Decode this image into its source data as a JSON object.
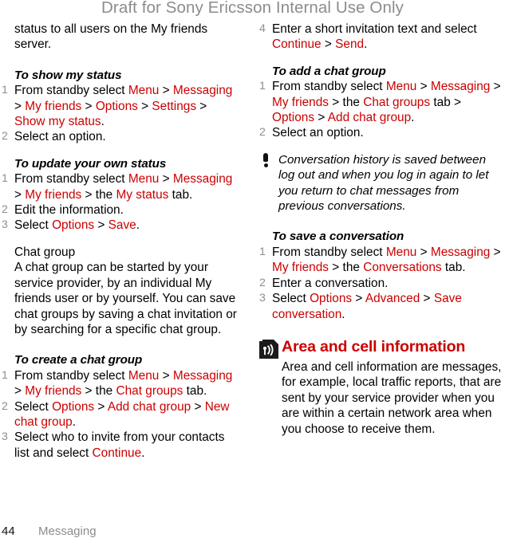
{
  "watermark": "Draft for Sony Ericsson Internal Use Only",
  "footer": {
    "page_number": "44",
    "chapter_title": "Messaging"
  },
  "colors": {
    "ui_term": "#cc0000",
    "watermark": "#8c8c8c",
    "step_number": "#8e8e8e",
    "body_text": "#000000"
  },
  "left_column": {
    "continued_paragraph": "status to all users on the My friends server.",
    "sections": [
      {
        "heading": "To show my status",
        "steps": [
          {
            "num": "1",
            "parts": [
              {
                "t": "From standby select ",
                "s": "plain"
              },
              {
                "t": "Menu",
                "s": "ui"
              },
              {
                "t": " > ",
                "s": "plain"
              },
              {
                "t": "Messaging",
                "s": "ui"
              },
              {
                "t": " > ",
                "s": "plain"
              },
              {
                "t": "My friends",
                "s": "ui"
              },
              {
                "t": " > ",
                "s": "plain"
              },
              {
                "t": "Options",
                "s": "ui"
              },
              {
                "t": " > ",
                "s": "plain"
              },
              {
                "t": "Settings",
                "s": "ui"
              },
              {
                "t": " > ",
                "s": "plain"
              },
              {
                "t": "Show my status",
                "s": "ui"
              },
              {
                "t": ".",
                "s": "plain"
              }
            ]
          },
          {
            "num": "2",
            "parts": [
              {
                "t": "Select an option.",
                "s": "plain"
              }
            ]
          }
        ]
      },
      {
        "heading": "To update your own status",
        "steps": [
          {
            "num": "1",
            "parts": [
              {
                "t": "From standby select ",
                "s": "plain"
              },
              {
                "t": "Menu",
                "s": "ui"
              },
              {
                "t": " > ",
                "s": "plain"
              },
              {
                "t": "Messaging",
                "s": "ui"
              },
              {
                "t": " > ",
                "s": "plain"
              },
              {
                "t": "My friends",
                "s": "ui"
              },
              {
                "t": " > the ",
                "s": "plain"
              },
              {
                "t": "My status",
                "s": "ui"
              },
              {
                "t": " tab.",
                "s": "plain"
              }
            ]
          },
          {
            "num": "2",
            "parts": [
              {
                "t": "Edit the information.",
                "s": "plain"
              }
            ]
          },
          {
            "num": "3",
            "parts": [
              {
                "t": "Select ",
                "s": "plain"
              },
              {
                "t": "Options",
                "s": "ui"
              },
              {
                "t": " > ",
                "s": "plain"
              },
              {
                "t": "Save",
                "s": "ui"
              },
              {
                "t": ".",
                "s": "plain"
              }
            ]
          }
        ]
      }
    ],
    "chat_group": {
      "heading": "Chat group",
      "body": "A chat group can be started by your service provider, by an individual My friends user or by yourself. You can save chat groups by saving a chat invitation or by searching for a specific chat group."
    },
    "create_chat_group": {
      "heading": "To create a chat group",
      "steps": [
        {
          "num": "1",
          "parts": [
            {
              "t": "From standby select ",
              "s": "plain"
            },
            {
              "t": "Menu",
              "s": "ui"
            },
            {
              "t": " > ",
              "s": "plain"
            },
            {
              "t": "Messaging",
              "s": "ui"
            },
            {
              "t": " > ",
              "s": "plain"
            },
            {
              "t": "My friends",
              "s": "ui"
            },
            {
              "t": " > the ",
              "s": "plain"
            },
            {
              "t": "Chat groups",
              "s": "ui"
            },
            {
              "t": " tab.",
              "s": "plain"
            }
          ]
        },
        {
          "num": "2",
          "parts": [
            {
              "t": "Select ",
              "s": "plain"
            },
            {
              "t": "Options",
              "s": "ui"
            },
            {
              "t": " > ",
              "s": "plain"
            },
            {
              "t": "Add chat group",
              "s": "ui"
            },
            {
              "t": " > ",
              "s": "plain"
            },
            {
              "t": "New chat group",
              "s": "ui"
            },
            {
              "t": ".",
              "s": "plain"
            }
          ]
        },
        {
          "num": "3",
          "parts": [
            {
              "t": "Select who to invite from your contacts list and select ",
              "s": "plain"
            },
            {
              "t": "Continue",
              "s": "ui"
            },
            {
              "t": ".",
              "s": "plain"
            }
          ]
        }
      ]
    }
  },
  "right_column": {
    "continued_step": {
      "num": "4",
      "parts": [
        {
          "t": "Enter a short invitation text and select ",
          "s": "plain"
        },
        {
          "t": "Continue",
          "s": "ui"
        },
        {
          "t": " > ",
          "s": "plain"
        },
        {
          "t": "Send",
          "s": "ui"
        },
        {
          "t": ".",
          "s": "plain"
        }
      ]
    },
    "add_chat_group": {
      "heading": "To add a chat group",
      "steps": [
        {
          "num": "1",
          "parts": [
            {
              "t": "From standby select ",
              "s": "plain"
            },
            {
              "t": "Menu",
              "s": "ui"
            },
            {
              "t": " > ",
              "s": "plain"
            },
            {
              "t": "Messaging",
              "s": "ui"
            },
            {
              "t": " > ",
              "s": "plain"
            },
            {
              "t": "My friends",
              "s": "ui"
            },
            {
              "t": " > the ",
              "s": "plain"
            },
            {
              "t": "Chat groups",
              "s": "ui"
            },
            {
              "t": " tab > ",
              "s": "plain"
            },
            {
              "t": "Options",
              "s": "ui"
            },
            {
              "t": " > ",
              "s": "plain"
            },
            {
              "t": "Add chat group",
              "s": "ui"
            },
            {
              "t": ".",
              "s": "plain"
            }
          ]
        },
        {
          "num": "2",
          "parts": [
            {
              "t": "Select an option.",
              "s": "plain"
            }
          ]
        }
      ]
    },
    "note": {
      "icon": "exclamation-icon",
      "text": "Conversation history is saved between log out and when you log in again to let you return to chat messages from previous conversations."
    },
    "save_conversation": {
      "heading": "To save a conversation",
      "steps": [
        {
          "num": "1",
          "parts": [
            {
              "t": "From standby select ",
              "s": "plain"
            },
            {
              "t": "Menu",
              "s": "ui"
            },
            {
              "t": " > ",
              "s": "plain"
            },
            {
              "t": "Messaging",
              "s": "ui"
            },
            {
              "t": " > ",
              "s": "plain"
            },
            {
              "t": "My friends",
              "s": "ui"
            },
            {
              "t": " > the ",
              "s": "plain"
            },
            {
              "t": "Conversations",
              "s": "ui"
            },
            {
              "t": " tab.",
              "s": "plain"
            }
          ]
        },
        {
          "num": "2",
          "parts": [
            {
              "t": "Enter a conversation.",
              "s": "plain"
            }
          ]
        },
        {
          "num": "3",
          "parts": [
            {
              "t": "Select ",
              "s": "plain"
            },
            {
              "t": "Options",
              "s": "ui"
            },
            {
              "t": " > ",
              "s": "plain"
            },
            {
              "t": "Advanced",
              "s": "ui"
            },
            {
              "t": " > ",
              "s": "plain"
            },
            {
              "t": "Save conversation",
              "s": "ui"
            },
            {
              "t": ".",
              "s": "plain"
            }
          ]
        }
      ]
    },
    "chapter": {
      "icon": "broadcast-antenna-icon",
      "title": "Area and cell information",
      "body": "Area and cell information are messages, for example, local traffic reports, that are sent by your service provider when you are within a certain network area when you choose to receive them."
    }
  }
}
